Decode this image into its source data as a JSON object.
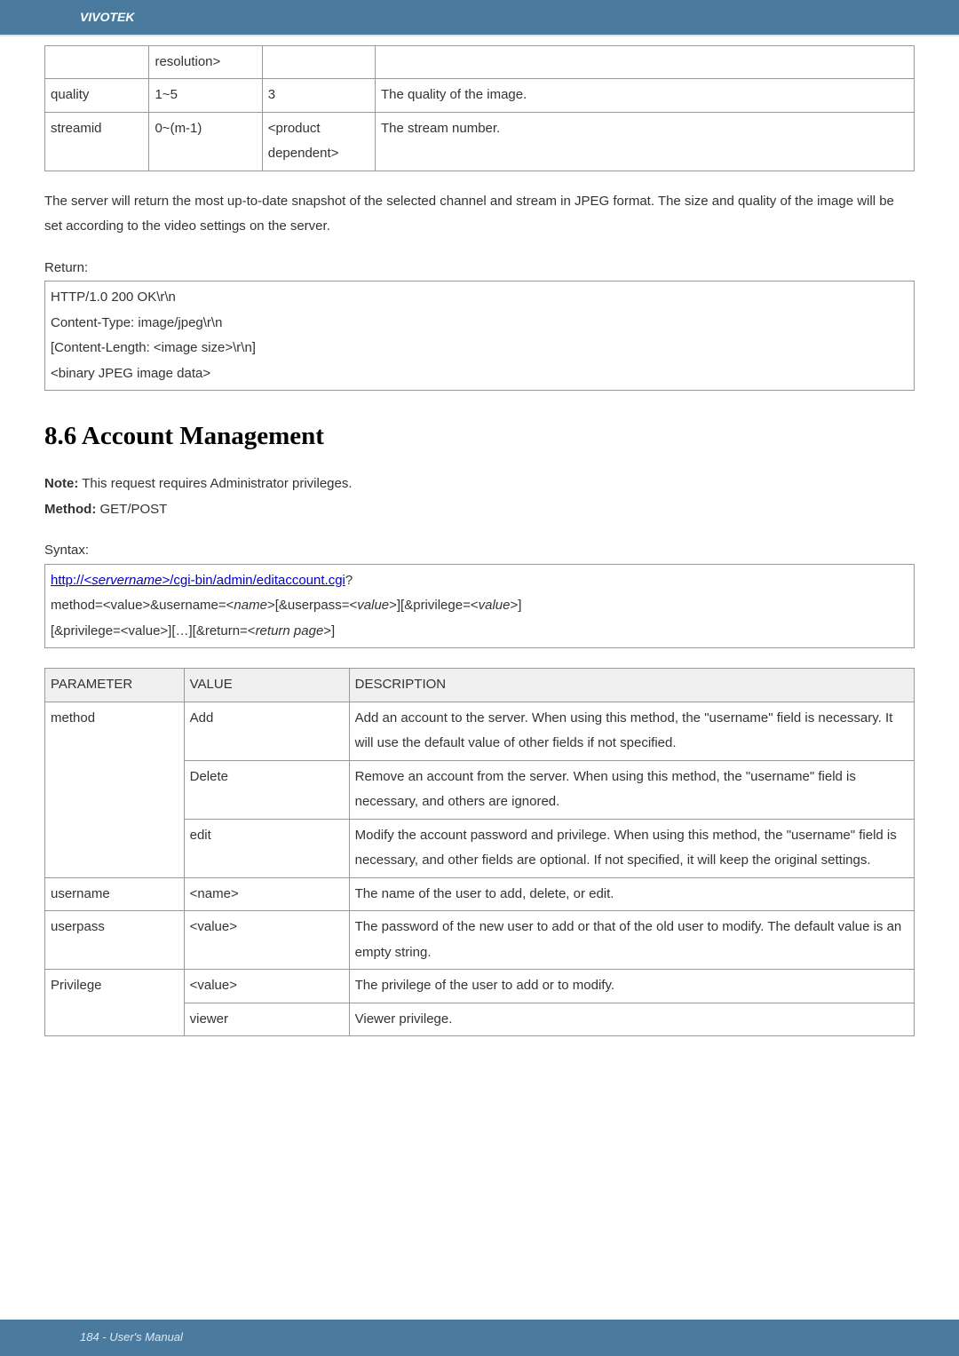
{
  "header": {
    "brand": "VIVOTEK"
  },
  "table1": {
    "rows": [
      {
        "c1": "",
        "c2": "resolution>",
        "c3": "",
        "c4": ""
      },
      {
        "c1": "quality",
        "c2": "1~5",
        "c3": "3",
        "c4": "The quality of the image."
      },
      {
        "c1": "streamid",
        "c2": "0~(m-1)",
        "c3": "<product dependent>",
        "c4": "The stream number."
      }
    ]
  },
  "para1": "The server will return the most up-to-date snapshot of the selected channel and stream in JPEG format. The size and quality of the image will be set according to the video settings on the server.",
  "return_label": "Return:",
  "return_block": {
    "l1": "HTTP/1.0 200 OK\\r\\n",
    "l2": "Content-Type: image/jpeg\\r\\n",
    "l3": "[Content-Length: <image size>\\r\\n]",
    "blank": " ",
    "l4": "<binary JPEG image data>"
  },
  "section": {
    "number": "8.6",
    "title": "Account Management"
  },
  "note": {
    "label": "Note:",
    "text": " This request requires Administrator privileges."
  },
  "method_line": {
    "label": "Method:",
    "text": " GET/POST"
  },
  "syntax_label": "Syntax:",
  "syntax": {
    "url_pre": "http://<",
    "url_serv": "servername",
    "url_post": ">/cgi-bin/admin/editaccount.cgi",
    "qmark": "?",
    "l2a": "method=<value>&username=<",
    "l2b": "name",
    "l2c": ">[&userpass=<",
    "l2d": "value",
    "l2e": ">][&privilege=<",
    "l2f": "value",
    "l2g": ">]",
    "l3a": "[&privilege=<value>][…][&return=<",
    "l3b": "return page",
    "l3c": ">]"
  },
  "table2": {
    "headers": {
      "p": "PARAMETER",
      "v": "VALUE",
      "d": "DESCRIPTION"
    },
    "rows": [
      {
        "p": "method",
        "v": "Add",
        "d": "Add an account to the server. When using this method, the \"username\" field is necessary. It will use the default value of other fields if not specified."
      },
      {
        "p": "",
        "v": "Delete",
        "d": "Remove an account from the server. When using this method, the \"username\" field is necessary, and others are ignored."
      },
      {
        "p": "",
        "v": "edit",
        "d": "Modify the account password and privilege. When using this method, the \"username\" field is necessary, and other fields are optional. If not specified, it will keep the original settings."
      },
      {
        "p": "username",
        "v": "<name>",
        "d": "The name of the user to add, delete, or edit."
      },
      {
        "p": "userpass",
        "v": "<value>",
        "d": "The password of the new user to add or that of the old user to modify. The default value is an empty string."
      },
      {
        "p": "Privilege",
        "v": "<value>",
        "d": "The privilege of the user to add or to modify."
      },
      {
        "p": "",
        "v": "viewer",
        "d": "Viewer privilege."
      }
    ]
  },
  "footer": {
    "text": "184 - User's Manual"
  }
}
